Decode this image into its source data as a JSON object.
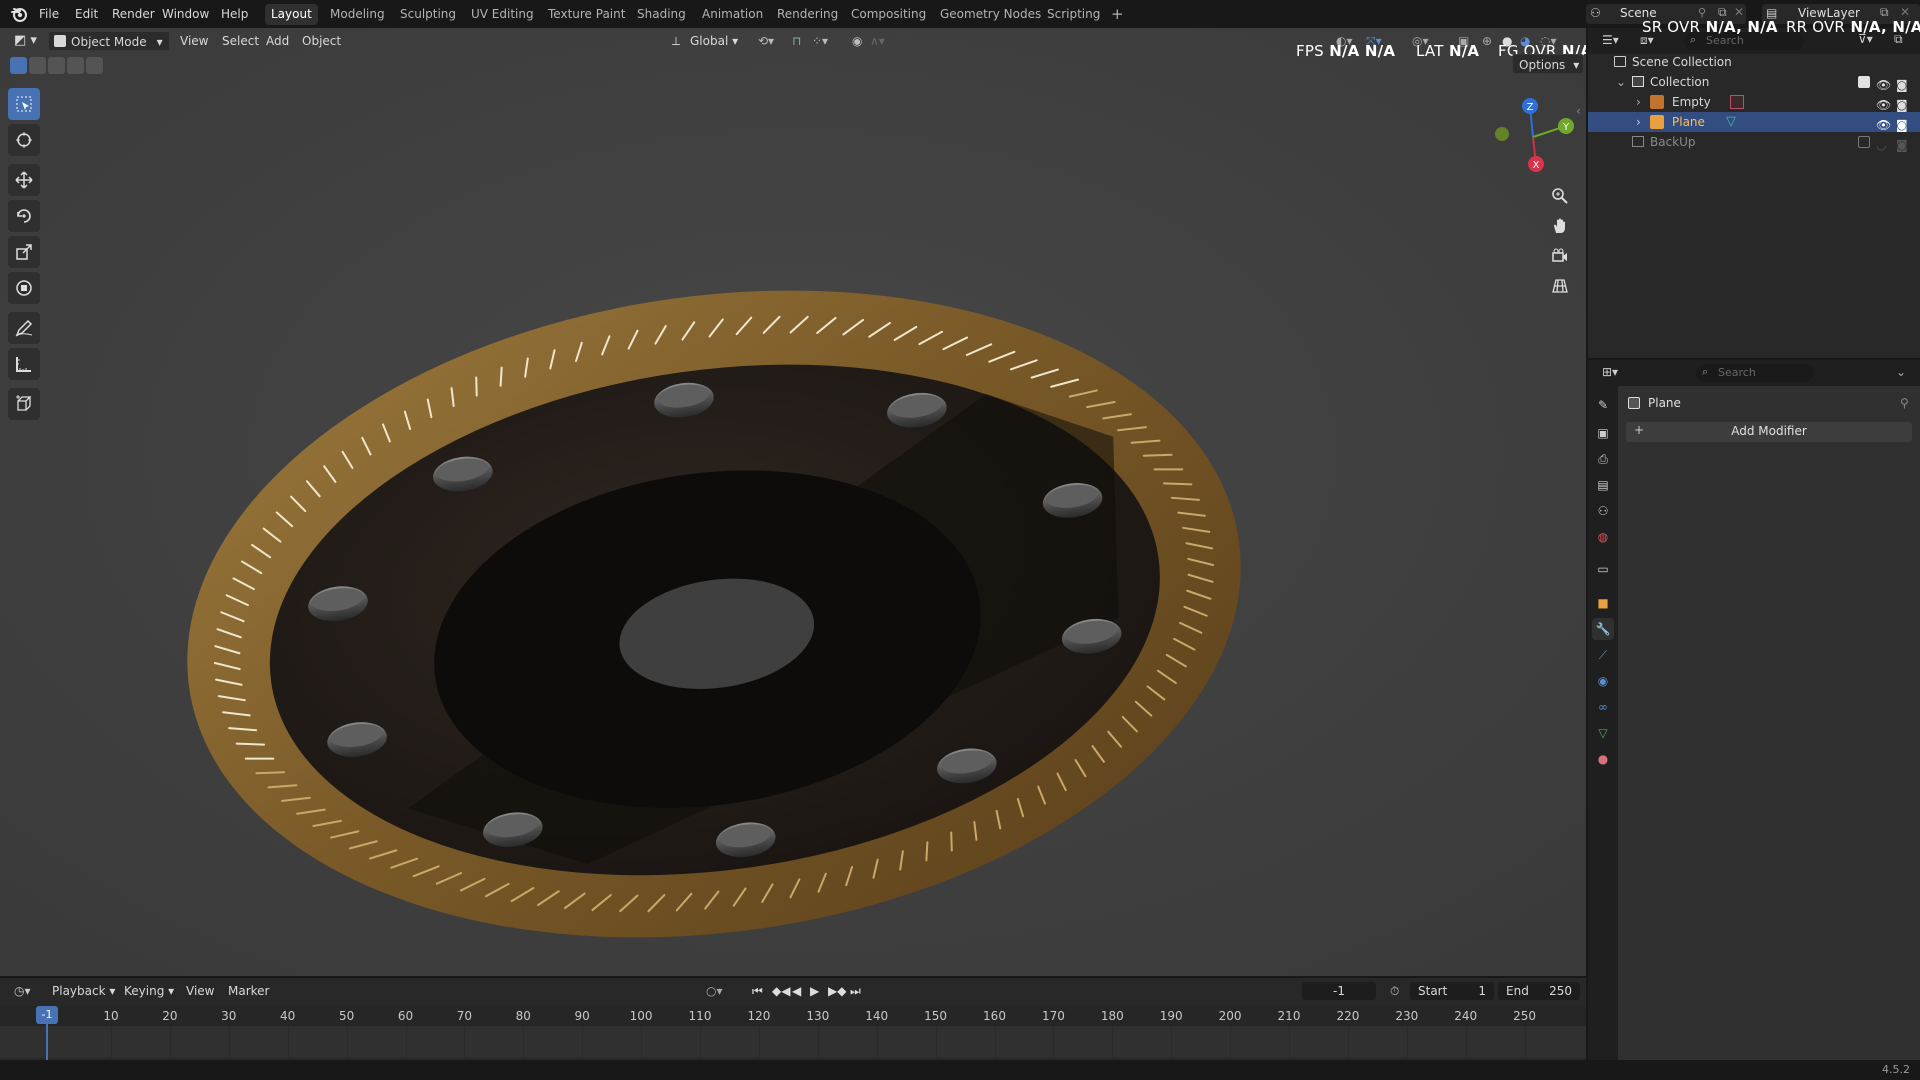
{
  "menubar": {
    "items": [
      "File",
      "Edit",
      "Render",
      "Window",
      "Help"
    ]
  },
  "workspaces": [
    "Layout",
    "Modeling",
    "Sculpting",
    "UV Editing",
    "Texture Paint",
    "Shading",
    "Animation",
    "Rendering",
    "Compositing",
    "Geometry Nodes",
    "Scripting"
  ],
  "workspace_add": "+",
  "scene": {
    "name": "Scene",
    "view_layer": "ViewLayer"
  },
  "viewport": {
    "mode": "Object Mode",
    "menus": [
      "View",
      "Select",
      "Add",
      "Object"
    ],
    "transform_orientation": "Global",
    "options_label": "Options",
    "overlay_stats": {
      "fps_label": "FPS",
      "fps_v1": "N/A",
      "fps_v2": "N/A",
      "lat_label": "LAT",
      "lat_v": "N/A",
      "fg_label": "FG OVR",
      "fg_v": "N/A,",
      "sr_label": "SR OVR",
      "sr_v": "N/A, N/A",
      "rr_label": "RR OVR",
      "rr_v": "N/A, N/A"
    },
    "gizmo": {
      "z": "Z",
      "y": "Y",
      "x": "X"
    },
    "search_placeholder": "Search"
  },
  "outliner": {
    "scene_collection": "Scene Collection",
    "collection": "Collection",
    "items": [
      {
        "name": "Empty",
        "selected": false
      },
      {
        "name": "Plane",
        "selected": true
      }
    ],
    "backup": "BackUp"
  },
  "properties": {
    "search_placeholder": "Search",
    "object_name": "Plane",
    "add_modifier": "Add Modifier"
  },
  "timeline": {
    "menus": [
      "Playback",
      "Keying",
      "View",
      "Marker"
    ],
    "current_frame": "-1",
    "start_label": "Start",
    "start_value": "1",
    "end_label": "End",
    "end_value": "250",
    "ruler_labels": [
      "10",
      "20",
      "30",
      "40",
      "50",
      "60",
      "70",
      "80",
      "90",
      "100",
      "110",
      "120",
      "130",
      "140",
      "150",
      "160",
      "170",
      "180",
      "190",
      "200",
      "210",
      "220",
      "230",
      "240",
      "250"
    ],
    "playhead_label": "-1"
  },
  "statusbar": {
    "version": "4.5.2"
  },
  "colors": {
    "accent": "#4772b3",
    "selection": "#334d80",
    "viewport_bg": "#3d3d3d",
    "bronze": "#8a6a36"
  }
}
